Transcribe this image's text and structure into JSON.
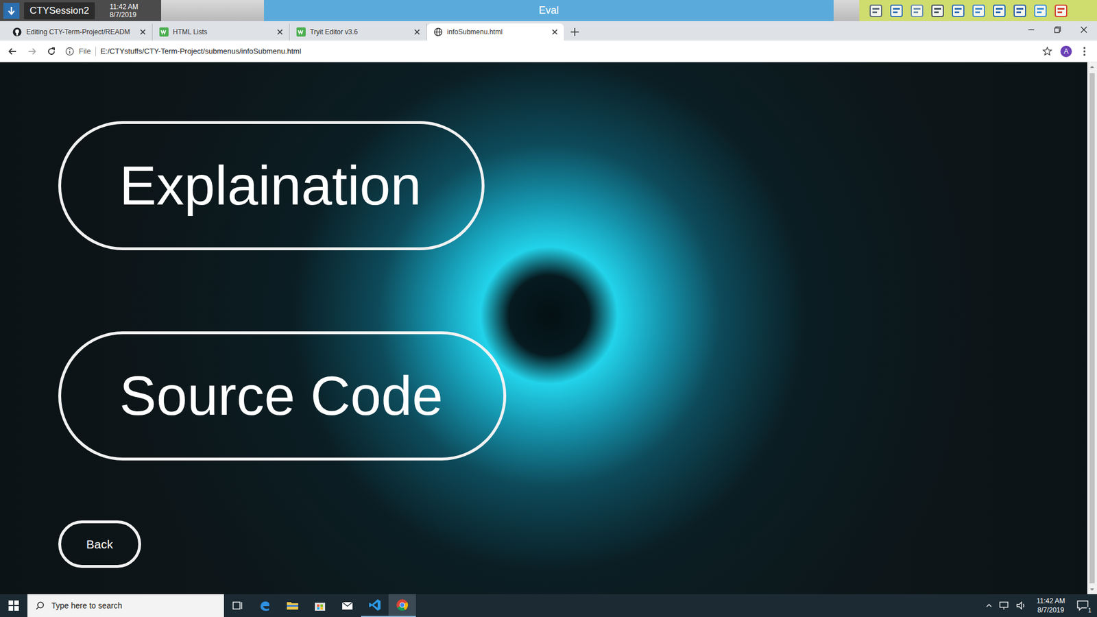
{
  "session_bar": {
    "name": "CTYSession2",
    "time": "11:42 AM",
    "date": "8/7/2019",
    "title": "Eval"
  },
  "browser": {
    "tabs": [
      {
        "label": "Editing CTY-Term-Project/READM",
        "selected": false,
        "kind": "github"
      },
      {
        "label": "HTML Lists",
        "selected": false,
        "kind": "w3"
      },
      {
        "label": "Tryit Editor v3.6",
        "selected": false,
        "kind": "w3"
      },
      {
        "label": "infoSubmenu.html",
        "selected": true,
        "kind": "globe"
      }
    ],
    "address": {
      "scheme": "File",
      "url": "E:/CTYstuffs/CTY-Term-Project/submenus/infoSubmenu.html"
    },
    "profile": "A"
  },
  "page": {
    "buttons": [
      {
        "label": "Explaination",
        "kind": "large"
      },
      {
        "label": "Source Code",
        "kind": "large"
      },
      {
        "label": "Back",
        "kind": "small"
      }
    ]
  },
  "taskbar": {
    "search_placeholder": "Type here to search",
    "time": "11:42 AM",
    "date": "8/7/2019",
    "notifications": "1"
  }
}
